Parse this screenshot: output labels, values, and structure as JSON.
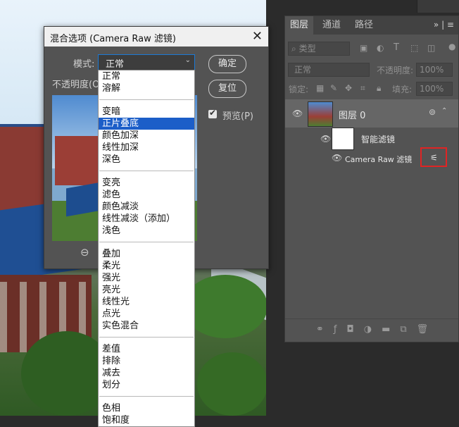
{
  "dialog": {
    "title": "混合选项 (Camera Raw 滤镜)",
    "mode_label": "模式:",
    "mode_value": "正常",
    "opacity_label": "不透明度(O",
    "ok_label": "确定",
    "reset_label": "复位",
    "preview_label": "预览(P)",
    "zoom_icon": "zoom-out-icon"
  },
  "dropdown": {
    "groups": [
      [
        "正常",
        "溶解"
      ],
      [
        "变暗",
        "正片叠底",
        "颜色加深",
        "线性加深",
        "深色"
      ],
      [
        "变亮",
        "滤色",
        "颜色减淡",
        "线性减淡（添加）",
        "浅色"
      ],
      [
        "叠加",
        "柔光",
        "强光",
        "亮光",
        "线性光",
        "点光",
        "实色混合"
      ],
      [
        "差值",
        "排除",
        "减去",
        "划分"
      ],
      [
        "色相",
        "饱和度"
      ]
    ],
    "selected": "正片叠底"
  },
  "layers_panel": {
    "tabs": [
      "图层",
      "通道",
      "路径"
    ],
    "active_tab": "图层",
    "filter_label": "类型",
    "blend_mode": "正常",
    "opacity_label": "不透明度:",
    "opacity_value": "100%",
    "lock_label": "锁定:",
    "fill_label": "填充:",
    "fill_value": "100%",
    "layer_name": "图层 0",
    "smart_filter_label": "智能滤镜",
    "filter_name": "Camera Raw 滤镜"
  },
  "colors": {
    "highlight": "#e02424",
    "selection": "#1c5ec8"
  }
}
